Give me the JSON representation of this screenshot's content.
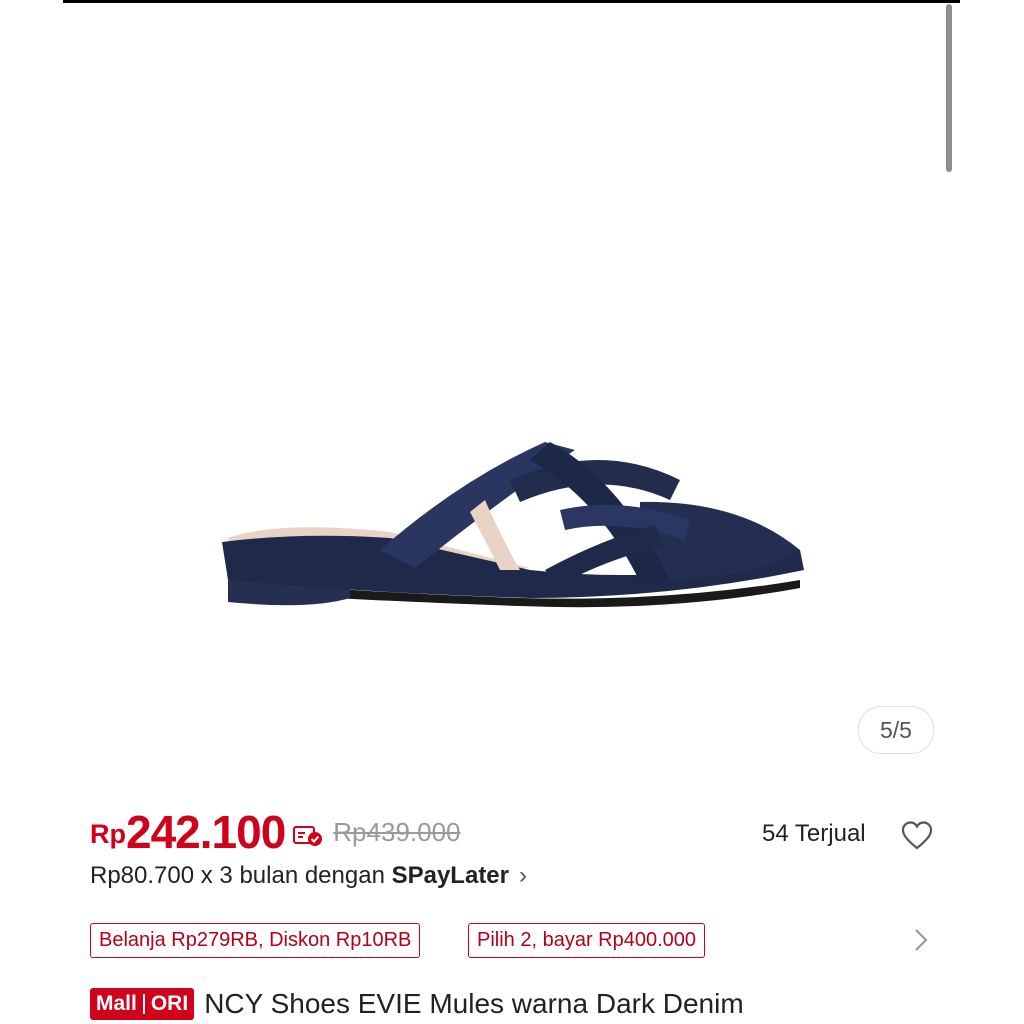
{
  "gallery": {
    "page_indicator": "5/5"
  },
  "price": {
    "currency": "Rp",
    "current": "242.100",
    "original": "Rp439.000"
  },
  "sold": {
    "label": "54 Terjual"
  },
  "installment": {
    "text": "Rp80.700 x 3 bulan dengan ",
    "provider": "SPayLater"
  },
  "promos": [
    {
      "label": "Belanja Rp279RB, Diskon Rp10RB"
    },
    {
      "label": "Pilih 2, bayar Rp400.000"
    }
  ],
  "badge": {
    "mall": "Mall",
    "ori": "ORI"
  },
  "product": {
    "title": "NCY Shoes EVIE Mules warna Dark Denim"
  },
  "colors": {
    "accent": "#d0011b",
    "denim": "#1f2a4a"
  },
  "icons": [
    "voucher-icon",
    "heart-icon",
    "chevron-right-icon"
  ]
}
